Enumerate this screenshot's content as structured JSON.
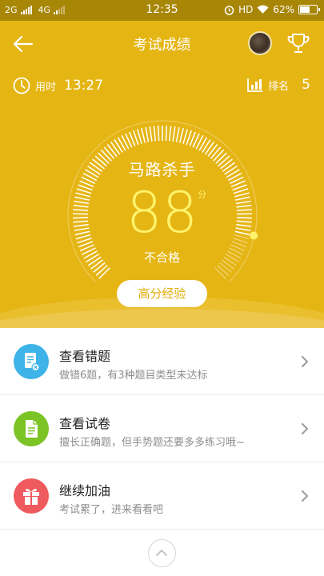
{
  "status_bar": {
    "net1": "2G",
    "net2": "4G",
    "time": "12:35",
    "hd": "HD",
    "battery_text": "62%",
    "battery_level": 0.62
  },
  "header": {
    "title": "考试成绩",
    "back_icon": "arrow-left-icon",
    "trophy_icon": "trophy-icon"
  },
  "stats": {
    "time_label": "用时",
    "time_value": "13:27",
    "rank_label": "排名",
    "rank_value": "5"
  },
  "score_card": {
    "grade_label": "马路杀手",
    "score": "88",
    "unit": "分",
    "result": "不合格",
    "progress": 0.88,
    "experience_button": "高分经验"
  },
  "menu": [
    {
      "title": "查看错题",
      "subtitle": "做错6题，有3种题目类型未达标",
      "icon": "wrong-questions-icon",
      "color": "#3db3e8"
    },
    {
      "title": "查看试卷",
      "subtitle": "擅长正确题，但手势题还要多多练习哦~",
      "icon": "exam-paper-icon",
      "color": "#7cc326"
    },
    {
      "title": "继续加油",
      "subtitle": "考试累了，进来看看吧",
      "icon": "gift-icon",
      "color": "#ee5a5e"
    }
  ],
  "colors": {
    "hero": "#e5b514",
    "score": "#fff36b",
    "button_text": "#e1ad0c"
  }
}
